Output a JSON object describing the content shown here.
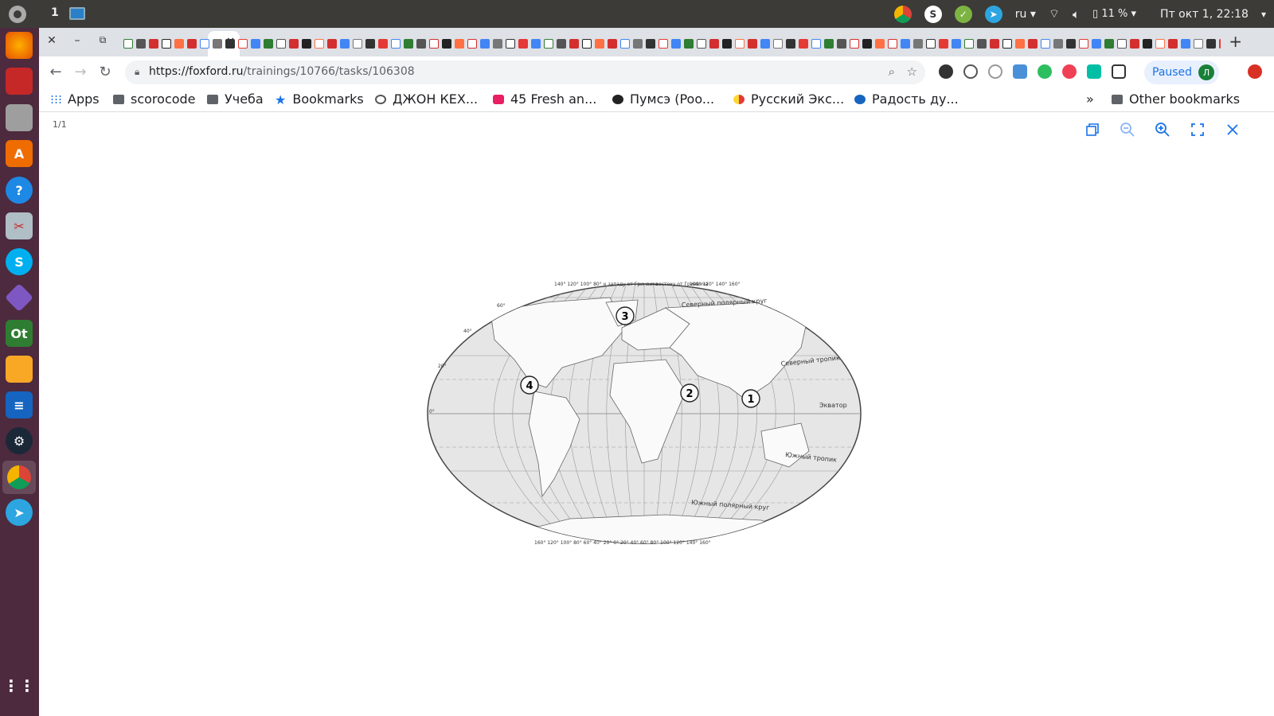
{
  "system_bar": {
    "workspace": "1",
    "language": "ru",
    "battery": "11 %",
    "clock": "Пт окт  1, 22:18"
  },
  "browser": {
    "url_host": "https://foxford.ru",
    "url_path": "/trainings/10766/tasks/106308",
    "paused_label": "Paused",
    "avatar_letter": "Л",
    "new_tab": "+"
  },
  "bookmarks": {
    "apps": "Apps",
    "items": [
      "scorocode",
      "Учеба",
      "Bookmarks",
      "ДЖОН КЕХ...",
      "45 Fresh an...",
      "Пумсэ (Poo...",
      "Русский Экс...",
      "Радость ду..."
    ],
    "overflow": "»",
    "other": "Other bookmarks"
  },
  "viewer": {
    "page_counter": "1/1"
  },
  "map": {
    "longitude_top_left": "140° 120° 100° 80°",
    "longitude_west_label": "к западу от Гринвича",
    "longitude_east_label": "к востоку от Гринвича",
    "longitude_top_right": "100° 120° 140° 160°",
    "longitude_bottom": "160° 120° 100° 80° 60° 40° 20° 0° 20° 40° 60° 80° 100° 120° 140° 160°",
    "arctic_circle": "Северный полярный круг",
    "tropic_north": "Северный тропик",
    "equator": "Экватор",
    "tropic_south": "Южный тропик",
    "antarctic_circle": "Южный полярный круг",
    "lat_60": "60°",
    "lat_40": "40°",
    "lat_20": "20°",
    "lat_0": "0°",
    "markers": [
      "1",
      "2",
      "3",
      "4"
    ]
  }
}
